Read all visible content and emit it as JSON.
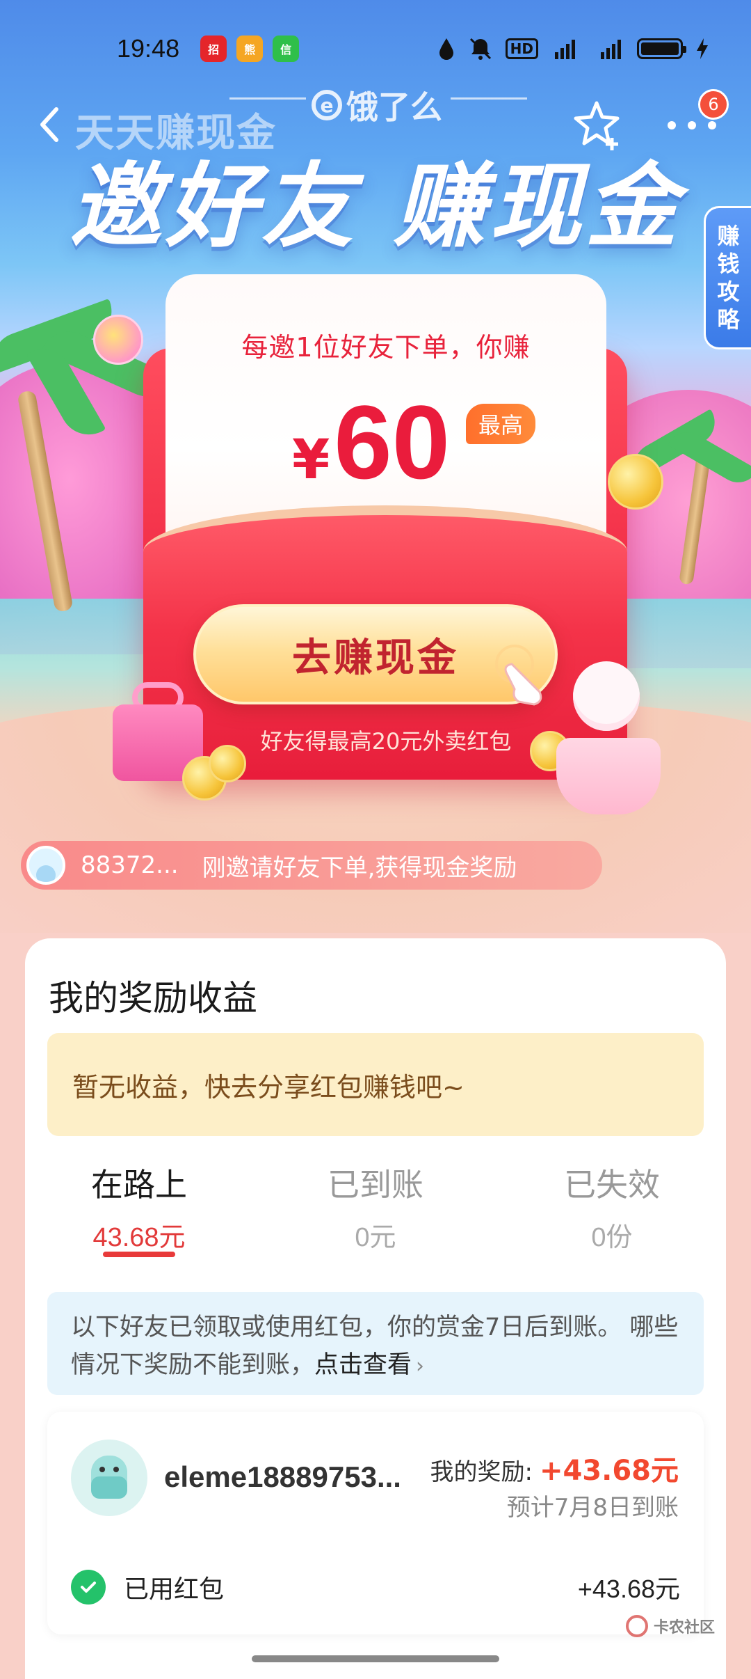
{
  "status_bar": {
    "time": "19:48",
    "apps": [
      "招",
      "熊",
      "信"
    ],
    "network": "4G 5G",
    "hd_label": "HD"
  },
  "nav": {
    "title": "天天赚现金",
    "brand": "饿了么",
    "notification_count": "6"
  },
  "hero": {
    "headline": "邀好友 赚现金",
    "side_tab": [
      "赚",
      "钱",
      "攻",
      "略"
    ]
  },
  "packet": {
    "subtitle": "每邀1位好友下单，你赚",
    "currency": "¥",
    "amount": "60",
    "max_tag": "最高",
    "cta": "去赚现金",
    "friend_note": "好友得最高20元外卖红包"
  },
  "ticker": {
    "user": "88372...",
    "message": "刚邀请好友下单,获得现金奖励"
  },
  "rewards": {
    "title": "我的奖励收益",
    "empty_message": "暂无收益，快去分享红包赚钱吧~",
    "tabs": [
      {
        "label": "在路上",
        "value": "43.68元"
      },
      {
        "label": "已到账",
        "value": "0元"
      },
      {
        "label": "已失效",
        "value": "0份"
      }
    ],
    "info_text": "以下好友已领取或使用红包，你的赏金7日后到账。 哪些情况下奖励不能到账，",
    "info_link": "点击查看",
    "friends": [
      {
        "name": "eleme18889753...",
        "reward_label": "我的奖励:",
        "reward_amount": "+43.68元",
        "eta": "预计7月8日到账",
        "status": "已用红包",
        "status_amount": "+43.68元"
      }
    ]
  },
  "watermark": {
    "text": "卡农社区"
  },
  "colors": {
    "accent_red": "#e91c3b",
    "reward_red": "#f2482f",
    "check_green": "#24c26a"
  }
}
